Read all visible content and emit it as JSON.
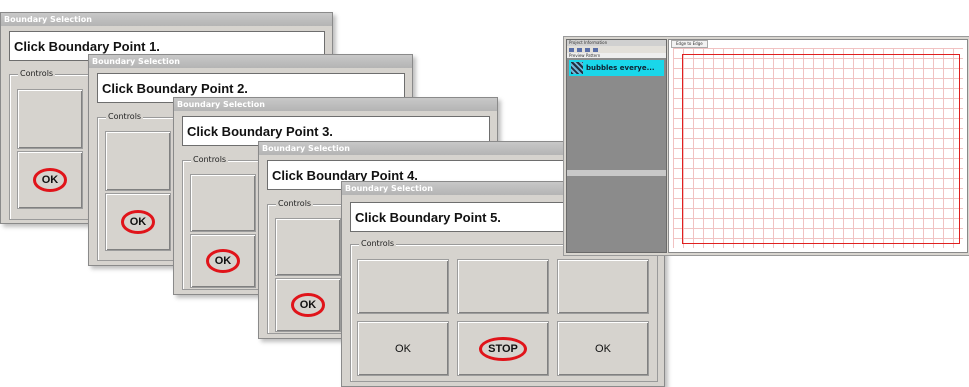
{
  "dialogs": [
    {
      "title": "Boundary Selection",
      "message": "Click Boundary Point 1.",
      "group_label": "Controls",
      "bottom_buttons": [
        "OK"
      ]
    },
    {
      "title": "Boundary Selection",
      "message": "Click Boundary Point 2.",
      "group_label": "Controls",
      "bottom_buttons": [
        "OK"
      ]
    },
    {
      "title": "Boundary Selection",
      "message": "Click Boundary Point 3.",
      "group_label": "Controls",
      "bottom_buttons": [
        "OK"
      ]
    },
    {
      "title": "Boundary Selection",
      "message": "Click Boundary Point 4.",
      "group_label": "Controls",
      "bottom_buttons": [
        "OK"
      ]
    },
    {
      "title": "Boundary Selection",
      "message": "Click Boundary Point 5.",
      "group_label": "Controls",
      "bottom_buttons": [
        "OK",
        "STOP",
        "OK"
      ]
    }
  ],
  "app": {
    "panel_title": "Project Information",
    "panel_columns": "Preview   Pattern",
    "row_text": "bubbles everye...",
    "canvas_tab": "Edge to Edge"
  },
  "colors": {
    "highlight": "#e0141a",
    "dialog_bg": "#d6d3ce"
  }
}
